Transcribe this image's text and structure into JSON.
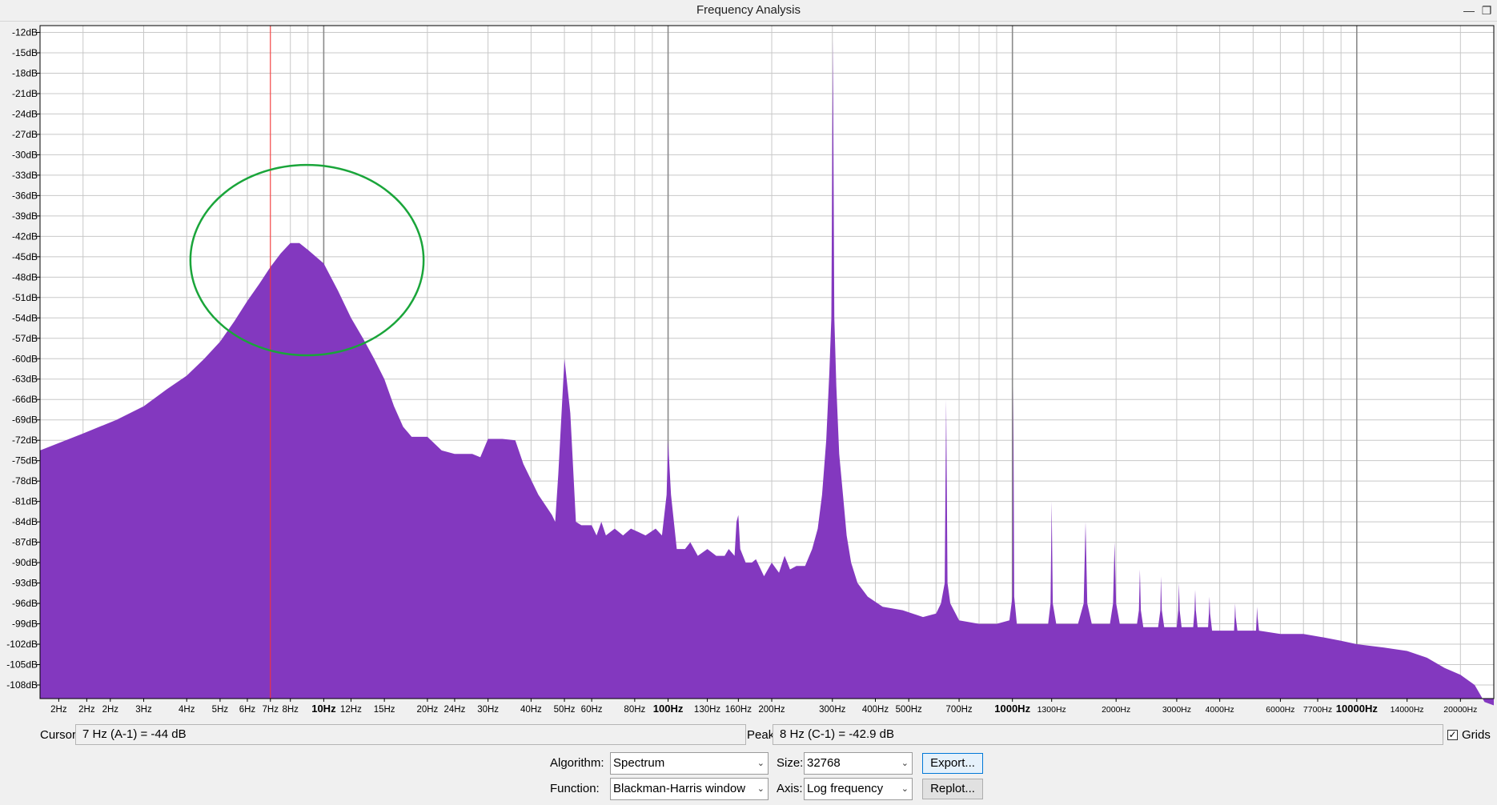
{
  "window": {
    "title": "Frequency Analysis",
    "minimize_glyph": "—",
    "restore_glyph": "❐"
  },
  "colors": {
    "spectrum_fill": "#8338bf",
    "cursor_line": "#ff3030",
    "annotation_ellipse": "#1aa53a",
    "grid_line": "#c8c8c8",
    "plot_background": "#ffffff"
  },
  "chart_data": {
    "type": "area",
    "x_scale": "log",
    "y_unit": "dB",
    "ylim": [
      -110,
      -11
    ],
    "xlim": [
      1.5,
      25000
    ],
    "grid": true,
    "y_ticks": [
      "-12dB",
      "-15dB",
      "-18dB",
      "-21dB",
      "-24dB",
      "-27dB",
      "-30dB",
      "-33dB",
      "-36dB",
      "-39dB",
      "-42dB",
      "-45dB",
      "-48dB",
      "-51dB",
      "-54dB",
      "-57dB",
      "-60dB",
      "-63dB",
      "-66dB",
      "-69dB",
      "-72dB",
      "-75dB",
      "-78dB",
      "-81dB",
      "-84dB",
      "-87dB",
      "-90dB",
      "-93dB",
      "-96dB",
      "-99dB",
      "-102dB",
      "-105dB",
      "-108dB"
    ],
    "x_tick_labels": [
      {
        "f": 1.7,
        "label": "2Hz"
      },
      {
        "f": 2.05,
        "label": "2Hz"
      },
      {
        "f": 2.4,
        "label": "2Hz"
      },
      {
        "f": 3,
        "label": "3Hz"
      },
      {
        "f": 4,
        "label": "4Hz"
      },
      {
        "f": 5,
        "label": "5Hz"
      },
      {
        "f": 6,
        "label": "6Hz"
      },
      {
        "f": 7,
        "label": "7Hz"
      },
      {
        "f": 8,
        "label": "8Hz"
      },
      {
        "f": 10,
        "label": "10Hz",
        "major": true
      },
      {
        "f": 12,
        "label": "12Hz"
      },
      {
        "f": 15,
        "label": "15Hz"
      },
      {
        "f": 20,
        "label": "20Hz"
      },
      {
        "f": 24,
        "label": "24Hz"
      },
      {
        "f": 30,
        "label": "30Hz"
      },
      {
        "f": 40,
        "label": "40Hz"
      },
      {
        "f": 50,
        "label": "50Hz"
      },
      {
        "f": 60,
        "label": "60Hz"
      },
      {
        "f": 80,
        "label": "80Hz"
      },
      {
        "f": 100,
        "label": "100Hz",
        "major": true
      },
      {
        "f": 130,
        "label": "130Hz"
      },
      {
        "f": 160,
        "label": "160Hz"
      },
      {
        "f": 200,
        "label": "200Hz"
      },
      {
        "f": 300,
        "label": "300Hz"
      },
      {
        "f": 400,
        "label": "400Hz"
      },
      {
        "f": 500,
        "label": "500Hz"
      },
      {
        "f": 700,
        "label": "700Hz"
      },
      {
        "f": 1000,
        "label": "1000Hz",
        "major": true
      },
      {
        "f": 1300,
        "label": "1300Hz"
      },
      {
        "f": 2000,
        "label": "2000Hz"
      },
      {
        "f": 3000,
        "label": "3000Hz"
      },
      {
        "f": 4000,
        "label": "4000Hz"
      },
      {
        "f": 6000,
        "label": "6000Hz"
      },
      {
        "f": 7700,
        "label": "7700Hz"
      },
      {
        "f": 10000,
        "label": "10000Hz",
        "major": true
      },
      {
        "f": 14000,
        "label": "14000Hz"
      },
      {
        "f": 20000,
        "label": "20000Hz"
      }
    ],
    "cursor_frequency_hz": 7,
    "annotation_ellipse": {
      "f_min": 4.1,
      "f_max": 19.5,
      "db_top": -31.5,
      "db_bottom": -59.5
    },
    "series": [
      {
        "points": [
          [
            1.5,
            -73.5
          ],
          [
            2,
            -71
          ],
          [
            2.5,
            -69
          ],
          [
            3,
            -67
          ],
          [
            3.5,
            -64.5
          ],
          [
            4,
            -62.5
          ],
          [
            4.5,
            -60
          ],
          [
            5,
            -57.5
          ],
          [
            5.5,
            -54.5
          ],
          [
            6,
            -51.5
          ],
          [
            6.5,
            -49
          ],
          [
            7,
            -46.5
          ],
          [
            7.5,
            -44.5
          ],
          [
            8,
            -43
          ],
          [
            8.5,
            -43
          ],
          [
            9,
            -44
          ],
          [
            10,
            -46
          ],
          [
            11,
            -50
          ],
          [
            12,
            -54
          ],
          [
            13,
            -57
          ],
          [
            14,
            -60
          ],
          [
            15,
            -63
          ],
          [
            16,
            -67
          ],
          [
            17,
            -70
          ],
          [
            18,
            -71.5
          ],
          [
            20,
            -71.5
          ],
          [
            22,
            -73.5
          ],
          [
            24,
            -74
          ],
          [
            27,
            -74
          ],
          [
            28.5,
            -74.5
          ],
          [
            30,
            -71.8
          ],
          [
            33,
            -71.8
          ],
          [
            36,
            -72
          ],
          [
            38,
            -75.5
          ],
          [
            42,
            -80
          ],
          [
            46,
            -83
          ],
          [
            47,
            -84
          ],
          [
            48,
            -77
          ],
          [
            50,
            -60
          ],
          [
            52,
            -68
          ],
          [
            54,
            -84
          ],
          [
            56,
            -84.5
          ],
          [
            60,
            -84.5
          ],
          [
            62,
            -86
          ],
          [
            64,
            -84
          ],
          [
            66,
            -86
          ],
          [
            70,
            -85
          ],
          [
            74,
            -86
          ],
          [
            78,
            -85
          ],
          [
            82,
            -85.5
          ],
          [
            86,
            -86
          ],
          [
            92,
            -85
          ],
          [
            96,
            -86
          ],
          [
            99,
            -80
          ],
          [
            100,
            -72
          ],
          [
            102,
            -80
          ],
          [
            106,
            -88
          ],
          [
            112,
            -88
          ],
          [
            116,
            -87
          ],
          [
            122,
            -89
          ],
          [
            130,
            -88
          ],
          [
            138,
            -89
          ],
          [
            146,
            -89
          ],
          [
            150,
            -88
          ],
          [
            156,
            -89
          ],
          [
            158,
            -84
          ],
          [
            160,
            -83
          ],
          [
            162,
            -88
          ],
          [
            168,
            -90
          ],
          [
            175,
            -90
          ],
          [
            180,
            -89.5
          ],
          [
            190,
            -92
          ],
          [
            200,
            -90
          ],
          [
            210,
            -91.5
          ],
          [
            218,
            -89
          ],
          [
            226,
            -91
          ],
          [
            236,
            -90.5
          ],
          [
            250,
            -90.5
          ],
          [
            262,
            -88
          ],
          [
            272,
            -85
          ],
          [
            280,
            -80
          ],
          [
            288,
            -72
          ],
          [
            294,
            -62
          ],
          [
            298,
            -54
          ],
          [
            301,
            -13
          ],
          [
            304,
            -54
          ],
          [
            308,
            -64
          ],
          [
            314,
            -74
          ],
          [
            322,
            -80
          ],
          [
            330,
            -86
          ],
          [
            340,
            -90
          ],
          [
            355,
            -93
          ],
          [
            380,
            -95
          ],
          [
            420,
            -96.5
          ],
          [
            480,
            -97
          ],
          [
            550,
            -98
          ],
          [
            600,
            -97.5
          ],
          [
            620,
            -96
          ],
          [
            636,
            -93
          ],
          [
            642,
            -66
          ],
          [
            648,
            -93
          ],
          [
            660,
            -96
          ],
          [
            700,
            -98.5
          ],
          [
            800,
            -99
          ],
          [
            900,
            -99
          ],
          [
            980,
            -98.5
          ],
          [
            1000,
            -95
          ],
          [
            1006,
            -64
          ],
          [
            1012,
            -95
          ],
          [
            1030,
            -99
          ],
          [
            1150,
            -99
          ],
          [
            1270,
            -99
          ],
          [
            1290,
            -96
          ],
          [
            1300,
            -81
          ],
          [
            1310,
            -96
          ],
          [
            1340,
            -99
          ],
          [
            1550,
            -99
          ],
          [
            1610,
            -96
          ],
          [
            1630,
            -84
          ],
          [
            1650,
            -96
          ],
          [
            1700,
            -99
          ],
          [
            1920,
            -99
          ],
          [
            1960,
            -96
          ],
          [
            1980,
            -87
          ],
          [
            2000,
            -96
          ],
          [
            2050,
            -99
          ],
          [
            2300,
            -99
          ],
          [
            2330,
            -97
          ],
          [
            2345,
            -91
          ],
          [
            2360,
            -97
          ],
          [
            2400,
            -99.5
          ],
          [
            2650,
            -99.5
          ],
          [
            2690,
            -97
          ],
          [
            2700,
            -92
          ],
          [
            2715,
            -97
          ],
          [
            2760,
            -99.5
          ],
          [
            3000,
            -99.5
          ],
          [
            3030,
            -97
          ],
          [
            3045,
            -93
          ],
          [
            3060,
            -97
          ],
          [
            3100,
            -99.5
          ],
          [
            3350,
            -99.5
          ],
          [
            3380,
            -97
          ],
          [
            3395,
            -94
          ],
          [
            3410,
            -97
          ],
          [
            3450,
            -99.5
          ],
          [
            3700,
            -99.5
          ],
          [
            3720,
            -97.5
          ],
          [
            3735,
            -95
          ],
          [
            3750,
            -97.5
          ],
          [
            3800,
            -100
          ],
          [
            4400,
            -100
          ],
          [
            4420,
            -98
          ],
          [
            4435,
            -96
          ],
          [
            4450,
            -98
          ],
          [
            4500,
            -100
          ],
          [
            5100,
            -100
          ],
          [
            5120,
            -98
          ],
          [
            5135,
            -96.5
          ],
          [
            5150,
            -98
          ],
          [
            5200,
            -100
          ],
          [
            6000,
            -100.5
          ],
          [
            7000,
            -100.5
          ],
          [
            8000,
            -101
          ],
          [
            9000,
            -101.5
          ],
          [
            10000,
            -102
          ],
          [
            12000,
            -102.5
          ],
          [
            14000,
            -103
          ],
          [
            16000,
            -104
          ],
          [
            18000,
            -105.5
          ],
          [
            20000,
            -106.5
          ],
          [
            22000,
            -108
          ],
          [
            23500,
            -110.5
          ],
          [
            25000,
            -111
          ]
        ]
      }
    ]
  },
  "status": {
    "cursor_label": "Cursor:",
    "cursor_value": "7 Hz (A-1) = -44 dB",
    "peak_label": "Peak:",
    "peak_value": "8 Hz (C-1) = -42.9 dB",
    "grids_label": "Grids",
    "grids_checked": true,
    "grids_check_glyph": "✓"
  },
  "controls": {
    "algorithm_label": "Algorithm:",
    "algorithm_value": "Spectrum",
    "size_label": "Size:",
    "size_value": "32768",
    "export_label": "Export...",
    "function_label": "Function:",
    "function_value": "Blackman-Harris window",
    "axis_label": "Axis:",
    "axis_value": "Log frequency",
    "replot_label": "Replot...",
    "dropdown_arrow": "⌄"
  }
}
